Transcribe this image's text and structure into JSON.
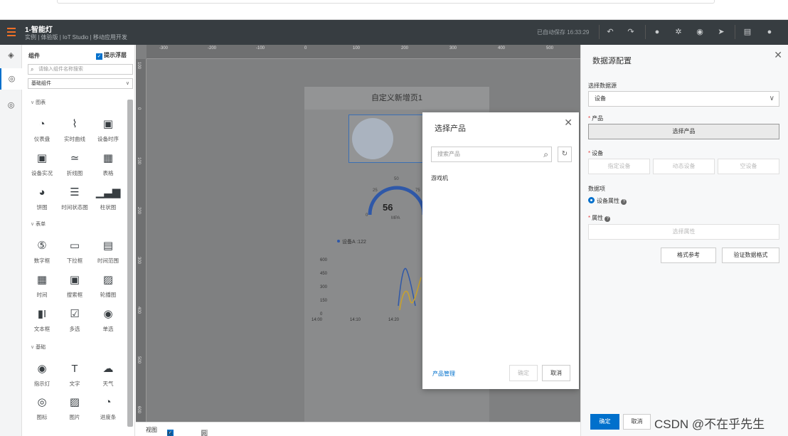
{
  "topbar": {
    "title": "1-智能灯",
    "subtitle": "实例 | 体验版 | IoT Studio | 移动应用开发",
    "saved": "已自动保存 16:33:29"
  },
  "panel": {
    "header": "组件",
    "float_tip": "提示浮层",
    "search_placeholder": "请输入组件名称搜索",
    "category": "基础组件",
    "sections": [
      "图表",
      "表单",
      "基础"
    ],
    "chart_items": [
      "仪表盘",
      "实时曲线",
      "设备时序",
      "设备实况",
      "折线图",
      "表格",
      "饼图",
      "时间状态图",
      "柱状图"
    ],
    "form_items": [
      "数字框",
      "下拉框",
      "时间范围",
      "时间",
      "搜索框",
      "轮播图",
      "文本框",
      "多选",
      "单选"
    ],
    "basic_items": [
      "指示灯",
      "文字",
      "天气",
      "图标",
      "图片",
      "进度条"
    ]
  },
  "canvas": {
    "ruler_h": [
      "-300",
      "-200",
      "-100",
      "0",
      "100",
      "200",
      "300",
      "400",
      "500"
    ],
    "ruler_v": [
      "100",
      "0",
      "100",
      "200",
      "300",
      "400",
      "500",
      "600"
    ],
    "page_title": "自定义新增页1",
    "gauge": {
      "value": "56",
      "unit": "MPA",
      "ticks": [
        "0",
        "25",
        "50",
        "75"
      ]
    },
    "legend": "设备A :122",
    "y_ticks": [
      "600",
      "450",
      "300",
      "150",
      "0"
    ],
    "x_ticks": [
      "14:00",
      "14:10",
      "14:20"
    ]
  },
  "bottombar": {
    "view": "视图",
    "ruler": "标尺",
    "grid": "网格"
  },
  "modal": {
    "title": "选择产品",
    "search_placeholder": "搜索产品",
    "item": "游戏机",
    "manage_link": "产品管理",
    "ok": "确定",
    "cancel": "取消"
  },
  "right": {
    "title": "数据源配置",
    "source_label": "选择数据源",
    "source_value": "设备",
    "product_label": "产品",
    "product_button": "选择产品",
    "device_label": "设备",
    "device_buttons": [
      "指定设备",
      "动态设备",
      "空设备"
    ],
    "dataitem_label": "数据项",
    "radio_label": "设备属性",
    "attr_label": "属性",
    "attr_placeholder": "选择属性",
    "format_ref": "格式参考",
    "verify_format": "验证数据格式",
    "ok": "确定",
    "cancel": "取消"
  },
  "watermark": "CSDN @不在乎先生",
  "colors": {
    "accent": "#0070cc",
    "topbar": "#373d41",
    "menu": "#ef7028"
  }
}
